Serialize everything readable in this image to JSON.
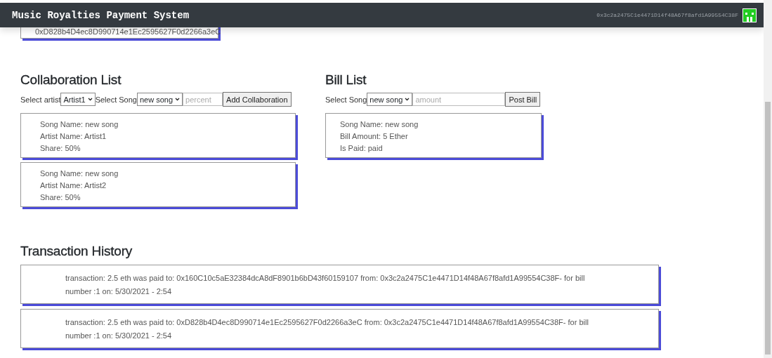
{
  "header": {
    "title": "Music Royalties Payment System",
    "account": "0x3c2a2475C1e4471D14f48A67f8afd1A99554C38F"
  },
  "top_card": {
    "text": "0xD828b4D4ec8D990714e1Ec2595627F0d2266a3eC"
  },
  "collaboration": {
    "title": "Collaboration List",
    "artist_label": "Select artist",
    "artist_value": "Artist1",
    "song_label": "Select Song",
    "song_value": "new song",
    "percent_placeholder": "percent",
    "button": "Add Collaboration",
    "items": [
      {
        "lines": [
          "Song Name: new song",
          "Artist Name: Artist1",
          "Share: 50%"
        ]
      },
      {
        "lines": [
          "Song Name: new song",
          "Artist Name: Artist2",
          "Share: 50%"
        ]
      }
    ]
  },
  "bills": {
    "title": "Bill List",
    "song_label": "Select Song",
    "song_value": "new song",
    "amount_placeholder": "amount",
    "button": "Post Bill",
    "items": [
      {
        "lines": [
          "Song Name: new song",
          "Bill Amount: 5 Ether",
          "Is Paid: paid"
        ]
      }
    ]
  },
  "transactions": {
    "title": "Transaction History",
    "items": [
      {
        "text": "transaction: 2.5 eth was paid to: 0x160C10c5aE32384dcA8dF8901b6bD43f60159107 from: 0x3c2a2475C1e4471D14f48A67f8afd1A99554C38F- for bill number :1 on: 5/30/2021 - 2:54"
      },
      {
        "text": "transaction: 2.5 eth was paid to: 0xD828b4D4ec8D990714e1Ec2595627F0d2266a3eC from: 0x3c2a2475C1e4471D14f48A67f8afd1A99554C38F- for bill number :1 on: 5/30/2021 - 2:54"
      }
    ]
  }
}
